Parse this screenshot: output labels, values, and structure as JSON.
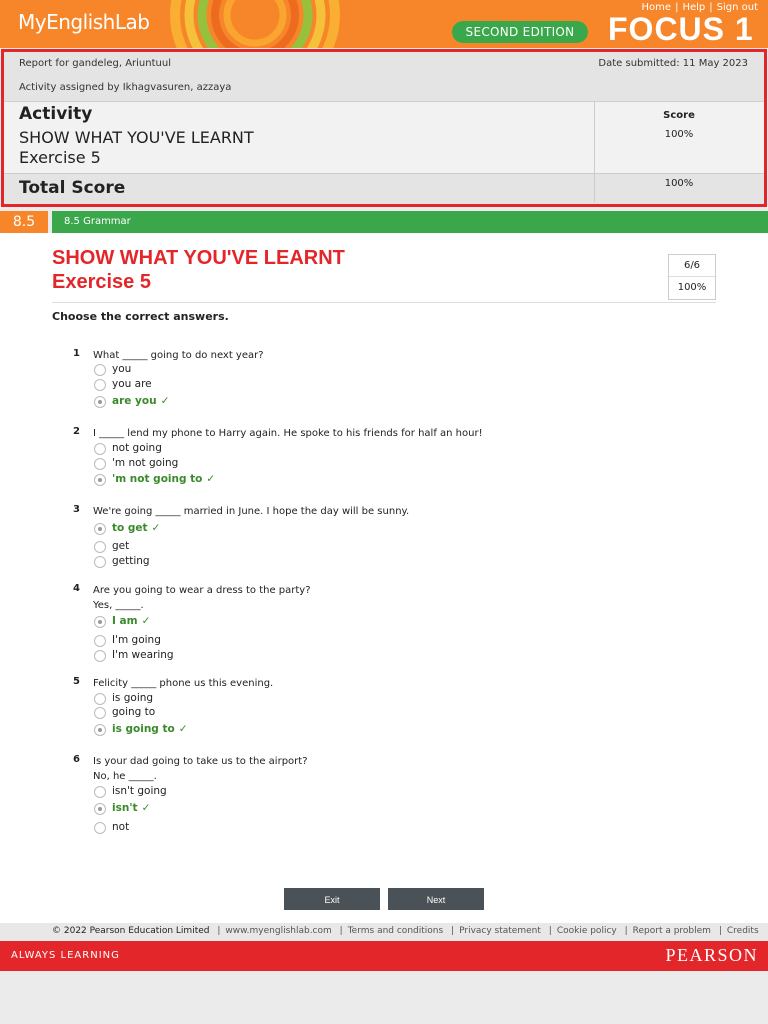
{
  "header": {
    "logo_my": "My",
    "logo_english": "English",
    "logo_lab": "Lab",
    "links": [
      "Home",
      "Help",
      "Sign out"
    ],
    "edition": "SECOND EDITION",
    "product": "FOCUS 1"
  },
  "report": {
    "report_for": "Report for gandeleg, Ariuntuul",
    "assigned_by": "Activity assigned by Ikhagvasuren, azzaya",
    "date_submitted": "Date submitted: 11 May 2023",
    "activity_label": "Activity",
    "activity_name_line1": "SHOW WHAT YOU'VE LEARNT",
    "activity_name_line2": "Exercise 5",
    "score_label": "Score",
    "activity_score": "100%",
    "total_label": "Total Score",
    "total_score": "100%"
  },
  "section": {
    "number": "8.5",
    "title": "8.5 Grammar"
  },
  "exercise": {
    "title_line1": "SHOW WHAT YOU'VE LEARNT",
    "title_line2": "Exercise 5",
    "score_fraction": "6/6",
    "score_percent": "100%",
    "instruction": "Choose the correct answers.",
    "questions": [
      {
        "num": "1",
        "line1": "What _____ going to do next year?",
        "line2": "",
        "options": [
          "you",
          "you are",
          "are you"
        ],
        "selected": 2
      },
      {
        "num": "2",
        "line1": "I _____ lend my phone to Harry again. He spoke to his friends for half an hour!",
        "line2": "",
        "options": [
          "not going",
          "'m not going",
          "'m not going to"
        ],
        "selected": 2
      },
      {
        "num": "3",
        "line1": "We're going _____ married in June. I hope the day will be sunny.",
        "line2": "",
        "options": [
          "to get",
          "get",
          "getting"
        ],
        "selected": 0
      },
      {
        "num": "4",
        "line1": "Are you going to wear a dress to the party?",
        "line2": "Yes, _____.",
        "options": [
          "I am",
          "I'm going",
          "I'm wearing"
        ],
        "selected": 0
      },
      {
        "num": "5",
        "line1": "Felicity _____ phone us this evening.",
        "line2": "",
        "options": [
          "is going",
          "going to",
          "is going to"
        ],
        "selected": 2
      },
      {
        "num": "6",
        "line1": "Is your dad going to take us to the airport?",
        "line2": "No, he _____.",
        "options": [
          "isn't going",
          "isn't",
          "not"
        ],
        "selected": 1
      }
    ],
    "exit_label": "Exit",
    "next_label": "Next"
  },
  "footer": {
    "copyright": "© 2022 Pearson Education Limited",
    "links": [
      "www.myenglishlab.com",
      "Terms and conditions",
      "Privacy statement",
      "Cookie policy",
      "Report a problem",
      "Credits"
    ],
    "tagline": "ALWAYS LEARNING",
    "brand": "PEARSON"
  },
  "colors": {
    "orange": "#f7862a",
    "green": "#3aa84a",
    "red": "#e3262a",
    "correct": "#3a8a2a"
  }
}
